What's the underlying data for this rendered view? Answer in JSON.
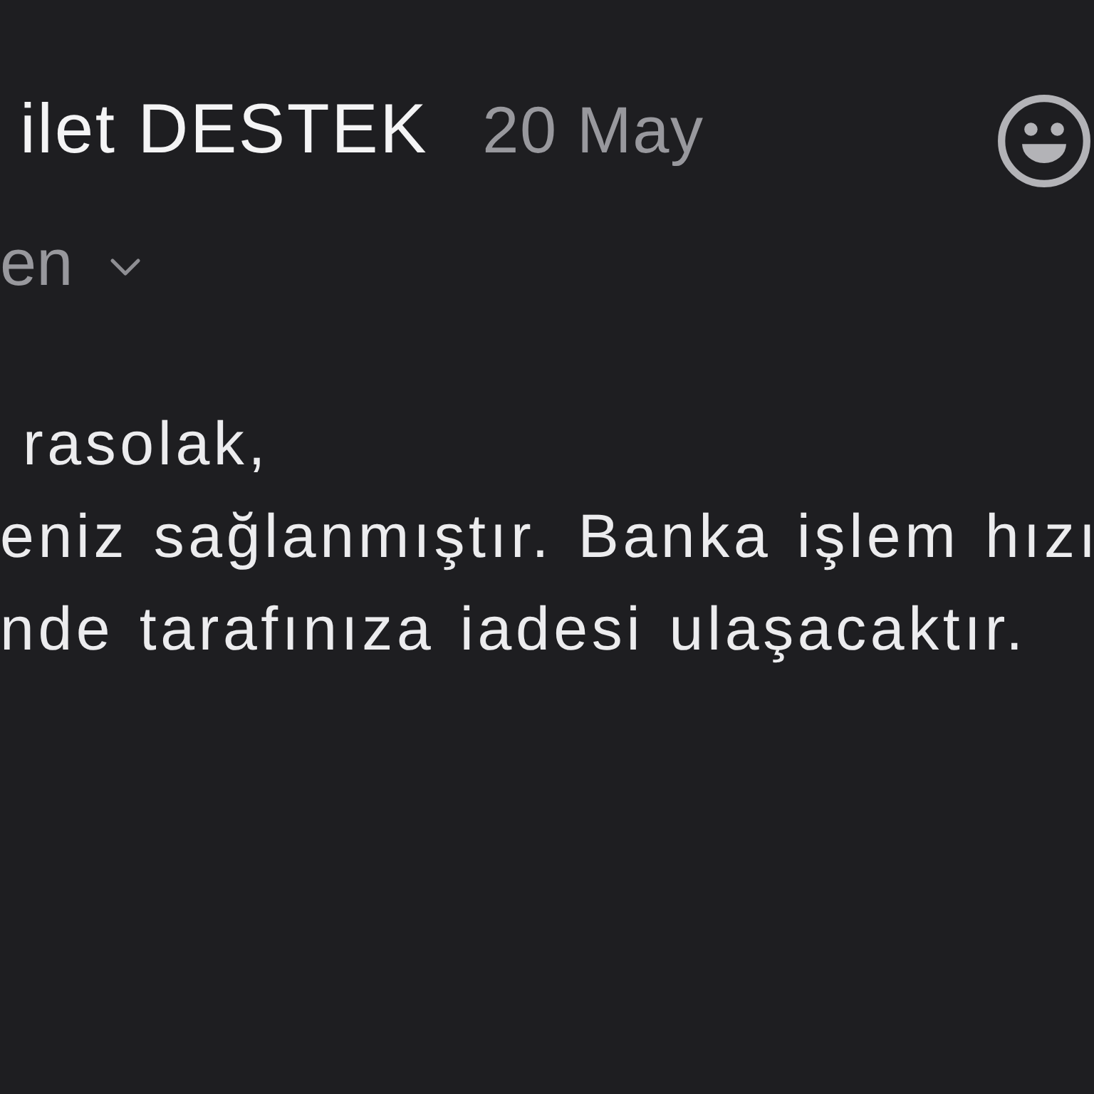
{
  "header": {
    "sender": "ilet DESTEK",
    "date": "20 May"
  },
  "recipient": {
    "label": "en",
    "expanded": false
  },
  "message": {
    "lines": [
      "rasolak,",
      "eniz sağlanmıştır. Banka işlem hızı",
      "nde tarafınıza iadesi ulaşacaktır."
    ]
  }
}
